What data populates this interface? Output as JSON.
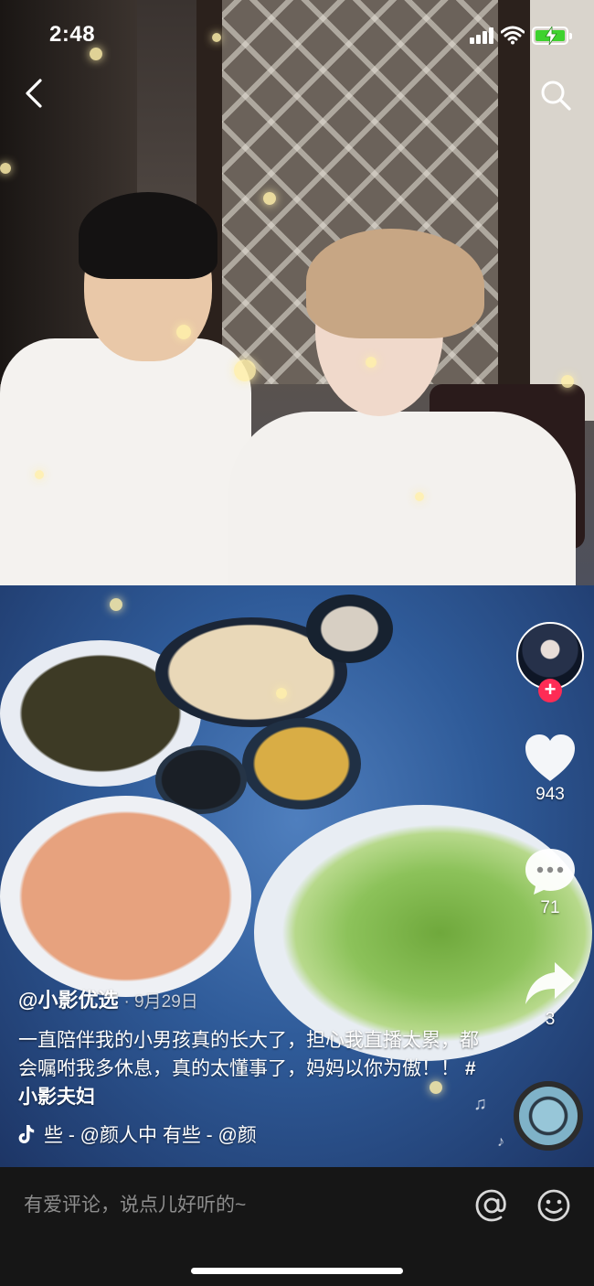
{
  "status_bar": {
    "time": "2:48"
  },
  "video": {
    "author": "@小影优选",
    "date": "· 9月29日",
    "description": "一直陪伴我的小男孩真的长大了，担心我直播太累，都会嘱咐我多休息，真的太懂事了，妈妈以你为傲！！",
    "hashtag": "#小影夫妇",
    "music": "些 - @颜人中    有些 - @颜"
  },
  "actions": {
    "likes": "943",
    "comments": "71",
    "shares": "3",
    "follow_label": "+"
  },
  "comment_bar": {
    "placeholder": "有爱评论，说点儿好听的~"
  },
  "icons": [
    "back-icon",
    "search-icon",
    "heart-icon",
    "comment-icon",
    "share-icon",
    "at-icon",
    "emoji-icon",
    "music-note-icon",
    "signal-icon",
    "wifi-icon",
    "battery-icon"
  ],
  "colors": {
    "accent": "#fe2c55",
    "battery": "#3ed22e",
    "comment_bar_bg": "#161616"
  }
}
